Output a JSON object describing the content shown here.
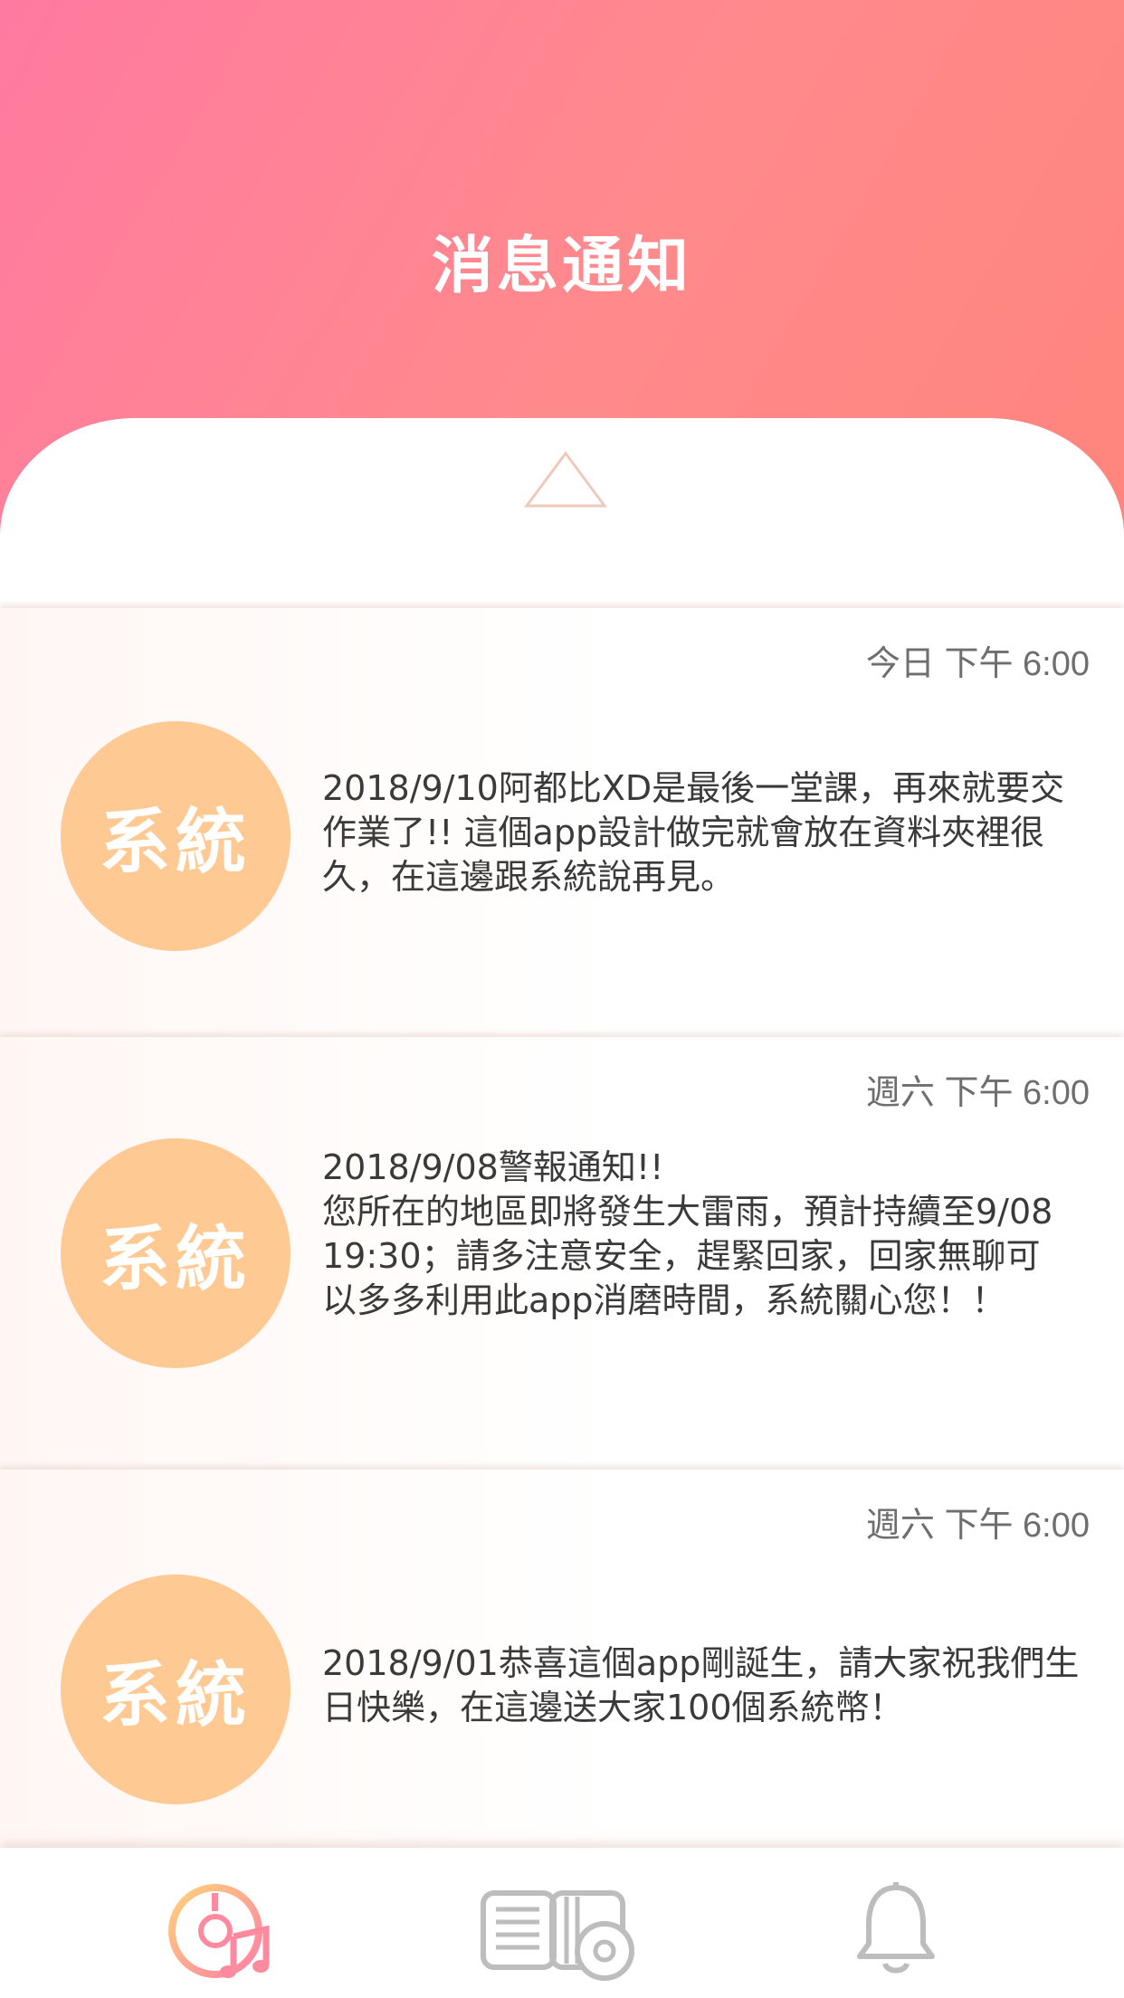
{
  "header": {
    "title": "消息通知"
  },
  "notifications": [
    {
      "time": "今日 下午 6:00",
      "sender": "系統",
      "message": "2018/9/10阿都比XD是最後一堂課，再來就要交作業了!! 這個app設計做完就會放在資料夾裡很久，在這邊跟系統說再見。"
    },
    {
      "time": "週六 下午 6:00",
      "sender": "系統",
      "message": "2018/9/08警報通知!!\n您所在的地區即將發生大雷雨，預計持續至9/08 19:30；請多注意安全，趕緊回家，回家無聊可以多多利用此app消磨時間，系統關心您！！"
    },
    {
      "time": "週六 下午 6:00",
      "sender": "系統",
      "message": "2018/9/01恭喜這個app剛誕生，請大家祝我們生日快樂，在這邊送大家100個系統幣！"
    }
  ],
  "tabbar": {
    "items": [
      {
        "icon": "music-disc-icon",
        "active": true
      },
      {
        "icon": "book-disc-icon",
        "active": false
      },
      {
        "icon": "bell-icon",
        "active": false
      }
    ]
  },
  "colors": {
    "header_gradient_start": "#ff7aa0",
    "header_gradient_end": "#ff857c",
    "avatar": "#ffc993",
    "time_text": "#6e6e6e",
    "body_text": "#3a3a3a"
  }
}
